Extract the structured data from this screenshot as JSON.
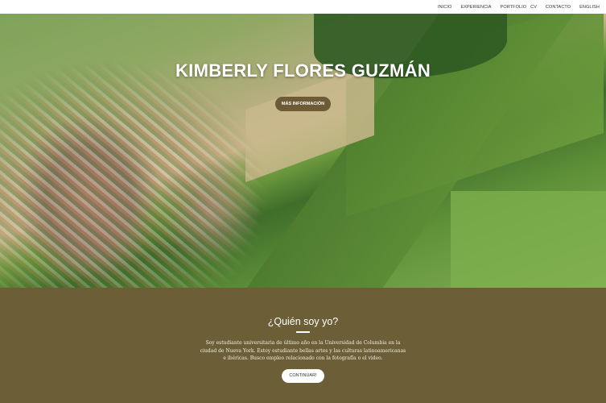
{
  "nav": {
    "items": [
      "INICIO",
      "EXPERIENCIA",
      "PORTFOLIO",
      "CV",
      "CONTACTO",
      "ENGLISH"
    ]
  },
  "hero": {
    "title": "KIMBERLY FLORES GUZMÁN",
    "button": "MÁS INFORMACIÓN",
    "background": "aerial-village-fields-photo"
  },
  "about": {
    "heading": "¿Quién soy yo?",
    "text": "Soy estudiante universitaria de último año en la Universidad de Columbia en la ciudad de Nueva York. Estoy estudiante bellas artes y las culturas latinoamericanas e ibéricas. Busco empleo relacionado con la fotografía o el video.",
    "button": "CONTINUAR!",
    "color": "#6c5f37"
  }
}
